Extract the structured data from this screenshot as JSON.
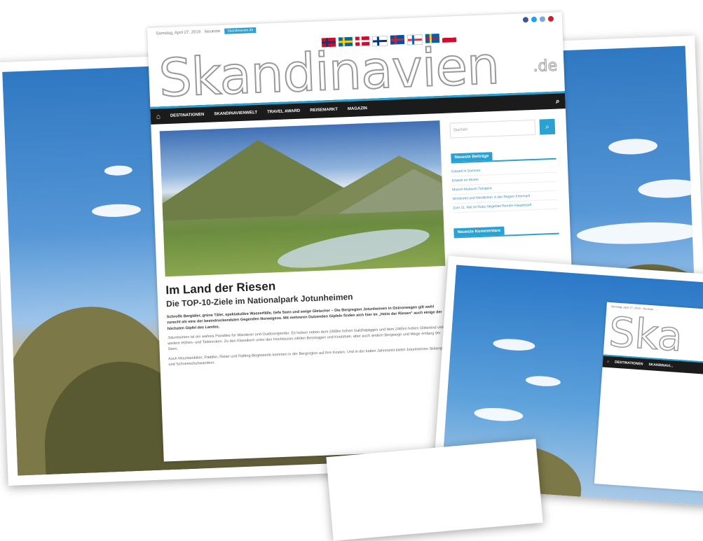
{
  "site": {
    "topbar": {
      "date": "Samstag, April 27, 2019",
      "tag": "Neueste",
      "label": "Skandinavien.de"
    },
    "logo": {
      "main": "Skandinavien",
      "suffix": ".de"
    },
    "nav": {
      "items": [
        "DESTINATIONEN",
        "SKANDINAVIENWELT",
        "TRAVEL AWARD",
        "REISEMARKT",
        "MAGAZIN"
      ]
    },
    "post": {
      "title": "Im Land der Riesen",
      "subtitle": "Die TOP-10-Ziele im Nationalpark Jotunheimen",
      "lead": "Schroffe Bergtäler, grüne Täler, spektakuläre Wasserfälle, tiefe Seen und ewige Gletscher – Die Bergregion Jotunheimen in Ostnorwegen gilt wohl zurecht als eine der beeindruckendsten Gegenden Norwegens. Mit mehreren Dutzenden Gipfeln finden sich hier im „Heim der Riesen“ auch einige der höchsten Gipfel des Landes.",
      "body1": "Jotunheimen ist ein wahres Paradies für Wanderer und Outdoorsportler. Es locken neben dem 2469m hohen Galdhøpiggen und dem 2465m hohen Glittertind viele weitere Höhen- und Talstrecken. Zu den Klassikern unter den Hochtouren zählen Besseggen und Knutshøe, aber auch andere Bergwege und Wege entlang der Seen.",
      "body2": "Auch Mountainbiker, Paddler, Reiter und Rafting-Begeisterte kommen in der Bergregion auf ihre Kosten. Und in der kalten Jahreszeit bietet Jotunheimen Skilanglauf und Schneeschuhwandern."
    },
    "sidebar": {
      "search_placeholder": "Suchen",
      "recent_title": "Neueste Beiträge",
      "recent_items": [
        "Eiswelt in Sommer",
        "Eiswelt im Winter",
        "Munch-Museum Tampere",
        "Winterzeit und Nordlichter in der Region Finnmark",
        "Zum 11. Mal ist Ruka Skigebiet Rentier-Hauptstadt"
      ],
      "comments_title": "Neueste Kommentare"
    }
  },
  "mini_site": {
    "topbar": "Samstag, April 27, 2019 · Neueste · ...",
    "logo": "Ska",
    "nav_items": [
      "DESTINATIONEN",
      "SKANDINAVI..."
    ]
  },
  "colors": {
    "accent": "#2aa1d1",
    "navbar": "#1b1b1b"
  },
  "icons": {
    "home": "home-icon",
    "search": "search-icon",
    "flags": [
      "norway-flag",
      "sweden-flag",
      "denmark-flag",
      "finland-flag",
      "iceland-flag",
      "faroe-flag",
      "aland-flag",
      "greenland-flag"
    ]
  }
}
